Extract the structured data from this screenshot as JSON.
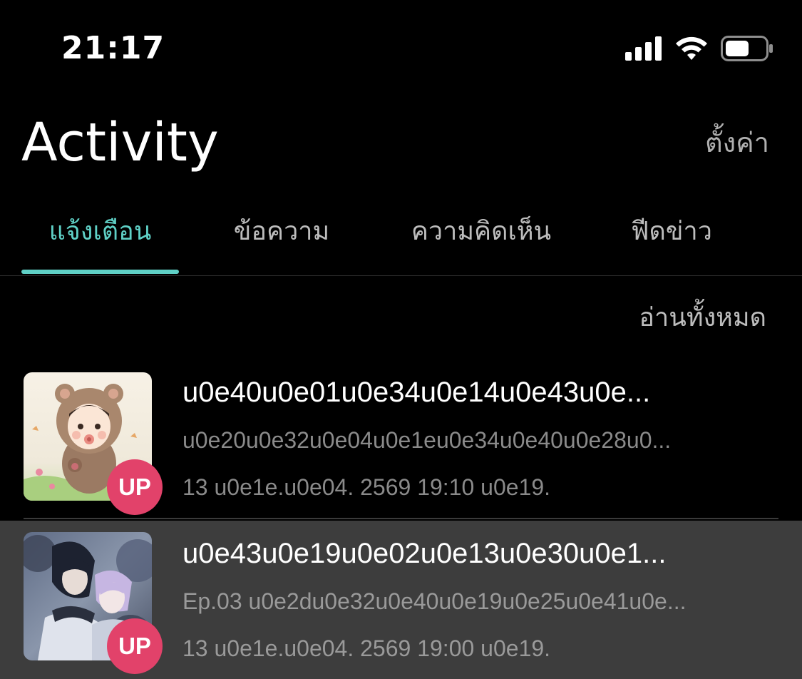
{
  "status_bar": {
    "time": "21:17",
    "signal_icon": "cellular-signal-icon",
    "wifi_icon": "wifi-icon",
    "battery_icon": "battery-icon",
    "battery_level": 0.6
  },
  "header": {
    "title": "Activity",
    "settings_label": "ตั้งค่า"
  },
  "tabs": [
    {
      "label": "แจ้งเตือน",
      "active": true
    },
    {
      "label": "ข้อความ",
      "active": false
    },
    {
      "label": "ความคิดเห็น",
      "active": false
    },
    {
      "label": "ฟีดข่าว",
      "active": false
    }
  ],
  "read_all_label": "อ่านทั้งหมด",
  "notifications": [
    {
      "title": "u0e40u0e01u0e34u0e14u0e43u0e...",
      "subtitle": "u0e20u0e32u0e04u0e1eu0e34u0e40u0e28u0...",
      "time": "13 u0e1e.u0e04. 2569 19:10 u0e19.",
      "badge": "UP",
      "thumbnail_icon": "bear-costume-baby-thumbnail"
    },
    {
      "title": "u0e43u0e19u0e02u0e13u0e30u0e1...",
      "subtitle": "Ep.03 u0e2du0e32u0e40u0e19u0e25u0e41u0e...",
      "time": "13 u0e1e.u0e04. 2569 19:00 u0e19.",
      "badge": "UP",
      "thumbnail_icon": "comic-couple-thumbnail"
    }
  ],
  "colors": {
    "background": "#000000",
    "accent": "#5fd0c6",
    "badge": "#e2426a",
    "selected_row": "#3d3d3d",
    "secondary_text": "#8a8a8a"
  }
}
